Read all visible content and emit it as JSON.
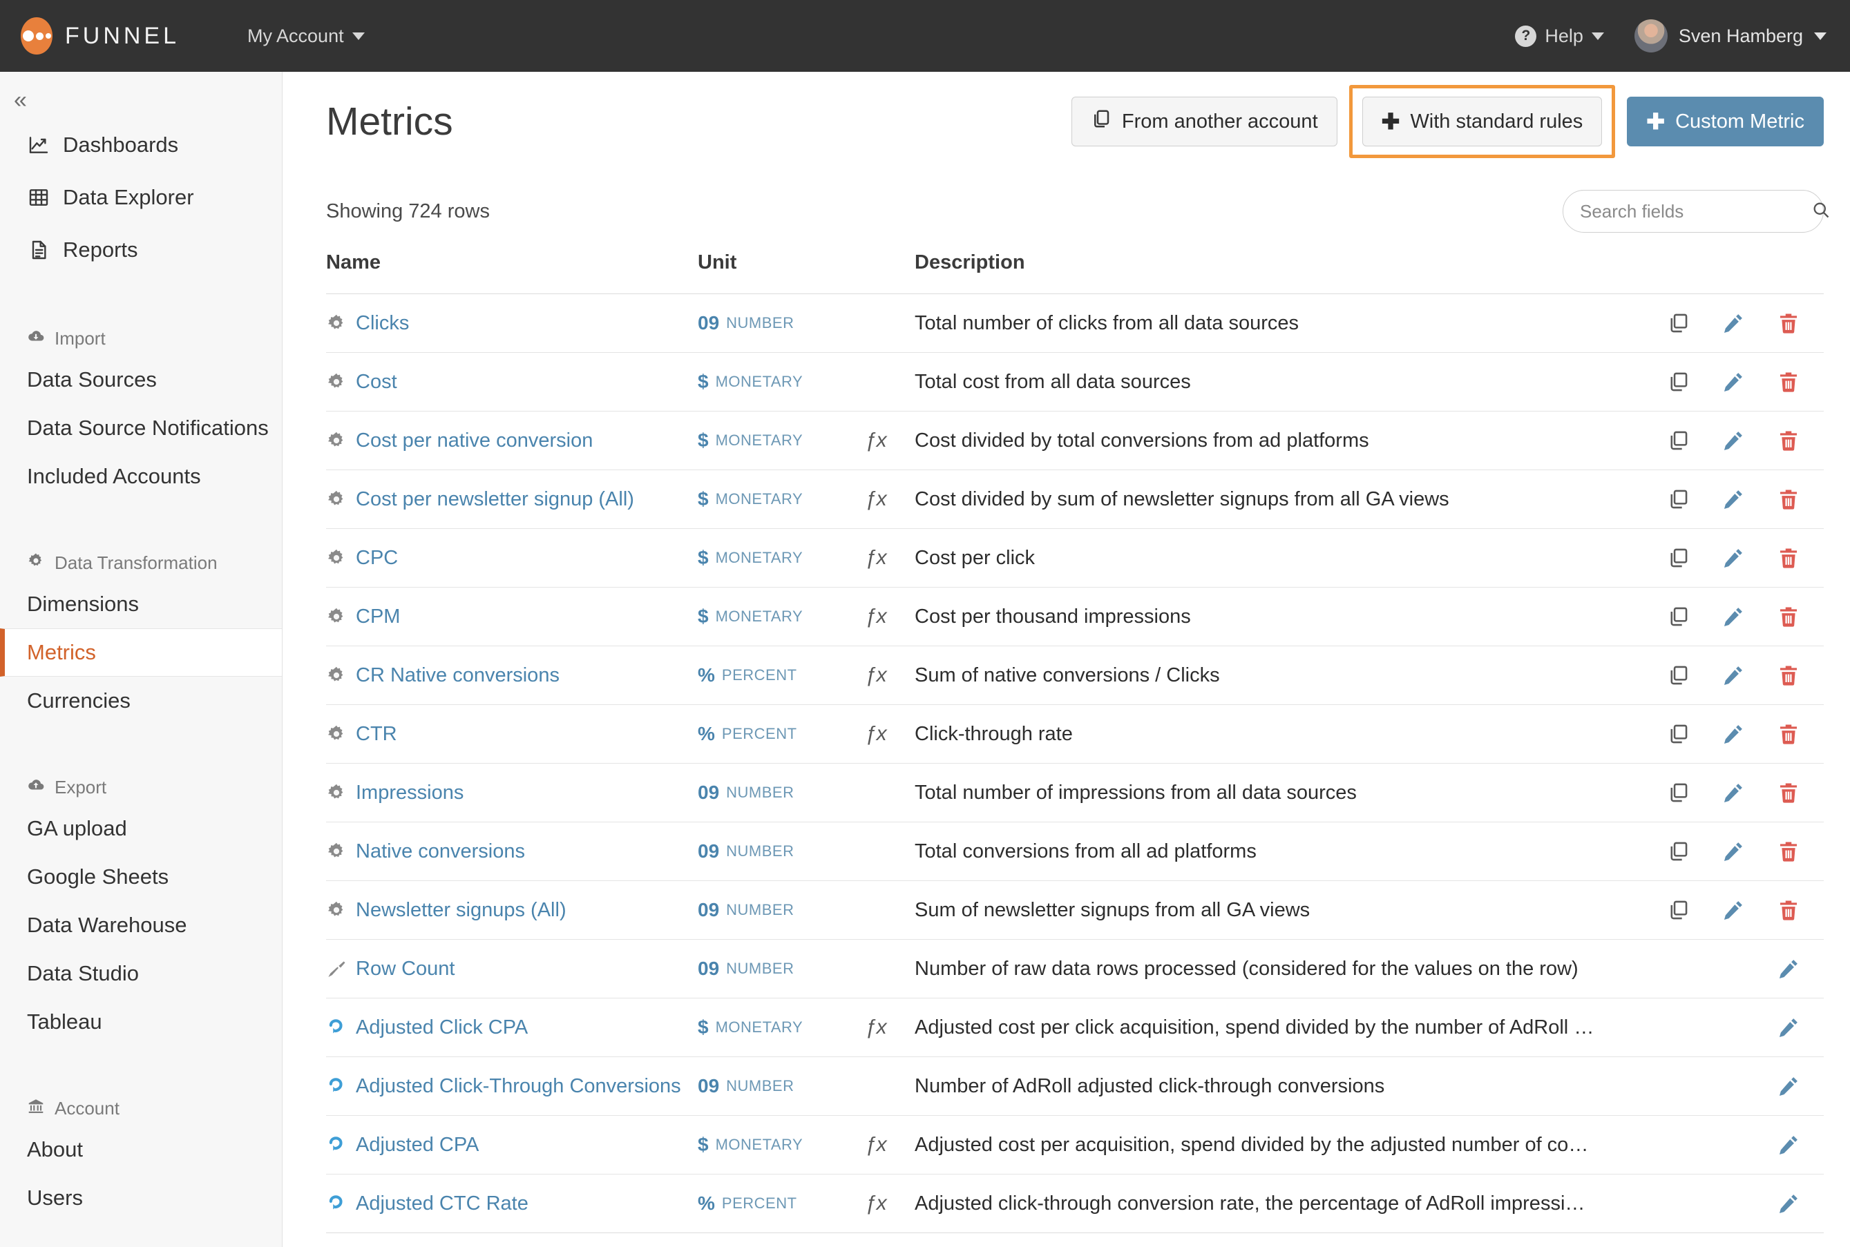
{
  "topbar": {
    "brand_name": "FUNNEL",
    "account_menu": "My Account",
    "help_label": "Help",
    "help_icon_glyph": "?",
    "user_name": "Sven Hamberg"
  },
  "sidebar": {
    "collapse_glyph": "«",
    "primary": [
      {
        "label": "Dashboards",
        "icon": "chart-line-icon"
      },
      {
        "label": "Data Explorer",
        "icon": "table-grid-icon"
      },
      {
        "label": "Reports",
        "icon": "document-icon"
      }
    ],
    "groups": [
      {
        "title": "Import",
        "icon": "cloud-download-icon",
        "items": [
          {
            "label": "Data Sources",
            "active": false
          },
          {
            "label": "Data Source Notifications",
            "active": false
          },
          {
            "label": "Included Accounts",
            "active": false
          }
        ]
      },
      {
        "title": "Data Transformation",
        "icon": "gear-icon",
        "items": [
          {
            "label": "Dimensions",
            "active": false
          },
          {
            "label": "Metrics",
            "active": true
          },
          {
            "label": "Currencies",
            "active": false
          }
        ]
      },
      {
        "title": "Export",
        "icon": "cloud-upload-icon",
        "items": [
          {
            "label": "GA upload",
            "active": false
          },
          {
            "label": "Google Sheets",
            "active": false
          },
          {
            "label": "Data Warehouse",
            "active": false
          },
          {
            "label": "Data Studio",
            "active": false
          },
          {
            "label": "Tableau",
            "active": false
          }
        ]
      },
      {
        "title": "Account",
        "icon": "bank-icon",
        "items": [
          {
            "label": "About",
            "active": false
          },
          {
            "label": "Users",
            "active": false
          }
        ]
      }
    ]
  },
  "page": {
    "title": "Metrics",
    "buttons": {
      "from_another_account": "From another account",
      "with_standard_rules": "With standard rules",
      "custom_metric": "Custom Metric",
      "plus_glyph": "✚"
    },
    "highlight_color": "#F2983C",
    "primary_color": "#5B8CAF",
    "accent_color": "#D2622A"
  },
  "table": {
    "showing": "Showing 724 rows",
    "search_placeholder": "Search fields",
    "search_value": "",
    "headers": {
      "name": "Name",
      "unit": "Unit",
      "description": "Description"
    },
    "rows": [
      {
        "name": "Clicks",
        "source_icon": "gear-icon",
        "unit_symbol": "09",
        "unit_label": "NUMBER",
        "fx": false,
        "description": "Total number of clicks from all data sources",
        "actions": [
          "copy-icon",
          "edit-icon",
          "delete-icon"
        ]
      },
      {
        "name": "Cost",
        "source_icon": "gear-icon",
        "unit_symbol": "$",
        "unit_label": "MONETARY",
        "fx": false,
        "description": "Total cost from all data sources",
        "actions": [
          "copy-icon",
          "edit-icon",
          "delete-icon"
        ]
      },
      {
        "name": "Cost per native conversion",
        "source_icon": "gear-icon",
        "unit_symbol": "$",
        "unit_label": "MONETARY",
        "fx": true,
        "description": "Cost divided by total conversions from ad platforms",
        "actions": [
          "copy-icon",
          "edit-icon",
          "delete-icon"
        ]
      },
      {
        "name": "Cost per newsletter signup (All)",
        "source_icon": "gear-icon",
        "unit_symbol": "$",
        "unit_label": "MONETARY",
        "fx": true,
        "description": "Cost divided by sum of newsletter signups from all GA views",
        "actions": [
          "copy-icon",
          "edit-icon",
          "delete-icon"
        ]
      },
      {
        "name": "CPC",
        "source_icon": "gear-icon",
        "unit_symbol": "$",
        "unit_label": "MONETARY",
        "fx": true,
        "description": "Cost per click",
        "actions": [
          "copy-icon",
          "edit-icon",
          "delete-icon"
        ]
      },
      {
        "name": "CPM",
        "source_icon": "gear-icon",
        "unit_symbol": "$",
        "unit_label": "MONETARY",
        "fx": true,
        "description": "Cost per thousand impressions",
        "actions": [
          "copy-icon",
          "edit-icon",
          "delete-icon"
        ]
      },
      {
        "name": "CR Native conversions",
        "source_icon": "gear-icon",
        "unit_symbol": "%",
        "unit_label": "PERCENT",
        "fx": true,
        "description": "Sum of native conversions / Clicks",
        "actions": [
          "copy-icon",
          "edit-icon",
          "delete-icon"
        ]
      },
      {
        "name": "CTR",
        "source_icon": "gear-icon",
        "unit_symbol": "%",
        "unit_label": "PERCENT",
        "fx": true,
        "description": "Click-through rate",
        "actions": [
          "copy-icon",
          "edit-icon",
          "delete-icon"
        ]
      },
      {
        "name": "Impressions",
        "source_icon": "gear-icon",
        "unit_symbol": "09",
        "unit_label": "NUMBER",
        "fx": false,
        "description": "Total number of impressions from all data sources",
        "actions": [
          "copy-icon",
          "edit-icon",
          "delete-icon"
        ]
      },
      {
        "name": "Native conversions",
        "source_icon": "gear-icon",
        "unit_symbol": "09",
        "unit_label": "NUMBER",
        "fx": false,
        "description": "Total conversions from all ad platforms",
        "actions": [
          "copy-icon",
          "edit-icon",
          "delete-icon"
        ]
      },
      {
        "name": "Newsletter signups (All)",
        "source_icon": "gear-icon",
        "unit_symbol": "09",
        "unit_label": "NUMBER",
        "fx": false,
        "description": "Sum of newsletter signups from all GA views",
        "actions": [
          "copy-icon",
          "edit-icon",
          "delete-icon"
        ]
      },
      {
        "name": "Row Count",
        "source_icon": "plug-icon",
        "unit_symbol": "09",
        "unit_label": "NUMBER",
        "fx": false,
        "description": "Number of raw data rows processed (considered for the values on the row)",
        "actions": [
          "edit-icon"
        ]
      },
      {
        "name": "Adjusted Click CPA",
        "source_icon": "adroll-icon",
        "unit_symbol": "$",
        "unit_label": "MONETARY",
        "fx": true,
        "description": "Adjusted cost per click acquisition, spend divided by the number of AdRoll adjusted click c...",
        "actions": [
          "edit-icon"
        ]
      },
      {
        "name": "Adjusted Click-Through Conversions",
        "source_icon": "adroll-icon",
        "unit_symbol": "09",
        "unit_label": "NUMBER",
        "fx": false,
        "description": "Number of AdRoll adjusted click-through conversions",
        "actions": [
          "edit-icon"
        ]
      },
      {
        "name": "Adjusted CPA",
        "source_icon": "adroll-icon",
        "unit_symbol": "$",
        "unit_label": "MONETARY",
        "fx": true,
        "description": "Adjusted cost per acquisition, spend divided by the adjusted number of conversions durin...",
        "actions": [
          "edit-icon"
        ]
      },
      {
        "name": "Adjusted CTC Rate",
        "source_icon": "adroll-icon",
        "unit_symbol": "%",
        "unit_label": "PERCENT",
        "fx": true,
        "description": "Adjusted click-through conversion rate, the percentage of AdRoll impressions that resulted...",
        "actions": [
          "edit-icon"
        ]
      }
    ]
  }
}
